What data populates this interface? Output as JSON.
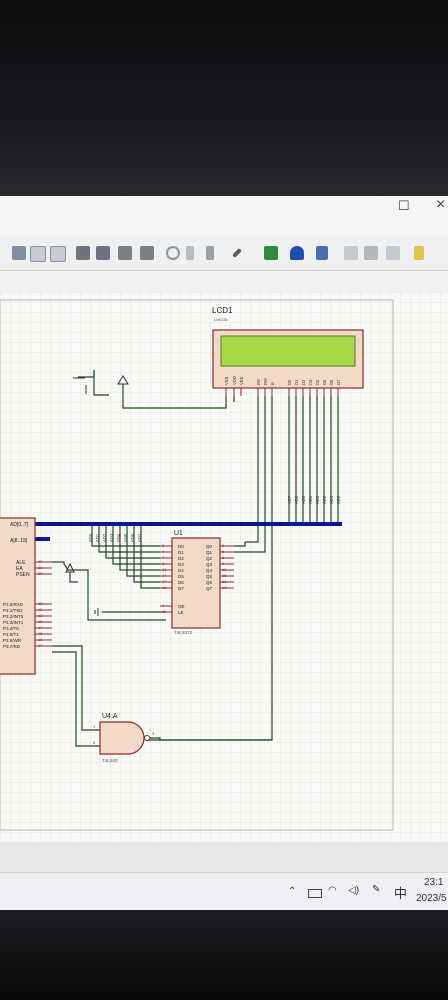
{
  "titlebar": {
    "maximize_glyph": "☐",
    "close_glyph": "×"
  },
  "toolbar": {
    "icons": [
      "cut-icon",
      "copy-icon",
      "paste-icon",
      "block-copy-icon",
      "block-move-icon",
      "block-rotate-icon",
      "block-delete-icon",
      "zoom-icon",
      "pick-device-icon",
      "make-device-icon",
      "decompose-icon",
      "wire-autorouter-icon",
      "search-icon",
      "property-tool-icon",
      "design-explorer-icon",
      "new-sheet-icon",
      "remove-sheet-icon",
      "export-icon"
    ]
  },
  "schematic": {
    "lcd": {
      "ref": "LCD1",
      "model": "LM016L",
      "pins": [
        "VSS",
        "VDD",
        "VEE",
        "RS",
        "RW",
        "E",
        "D0",
        "D1",
        "D2",
        "D3",
        "D4",
        "D5",
        "D6",
        "D7"
      ],
      "lcd_color": "#a8d84a"
    },
    "latch": {
      "ref": "U1",
      "model": "74LS373",
      "inputs": [
        "D0",
        "D1",
        "D2",
        "D3",
        "D4",
        "D5",
        "D6",
        "D7",
        "OE",
        "LE"
      ],
      "outputs": [
        "Q0",
        "Q1",
        "Q2",
        "Q3",
        "Q4",
        "Q5",
        "Q6",
        "Q7"
      ],
      "input_pin_nums": [
        "3",
        "4",
        "7",
        "8",
        "13",
        "14",
        "17",
        "18",
        "1",
        "11"
      ],
      "output_pin_nums": [
        "2",
        "5",
        "6",
        "9",
        "12",
        "15",
        "16",
        "19"
      ]
    },
    "gate": {
      "ref": "U4:A",
      "model": "74LS00",
      "pin_in1": "1",
      "pin_in2": "2",
      "pin_out": "3"
    },
    "mcu": {
      "left_labels": [
        "AD[0..7]",
        "A[8..15]"
      ],
      "control_labels": [
        "ALE",
        "EA",
        "PSEN"
      ],
      "control_pins": [
        "30",
        "31",
        "29"
      ],
      "port3_labels": [
        "P3.0/RXD",
        "P3.1/TXD",
        "P3.2/INT0",
        "P3.3/INT1",
        "P3.4/T0",
        "P3.5/T1",
        "P3.6/WR",
        "P3.7/RD"
      ],
      "port3_pins": [
        "10",
        "11",
        "12",
        "13",
        "14",
        "15",
        "16",
        "17"
      ]
    },
    "bus_labels_upper": [
      "AD0",
      "AD1",
      "AD2",
      "AD3",
      "AD4",
      "AD5",
      "AD6",
      "AD7"
    ],
    "bus_labels_lower": [
      "AD7",
      "AD6",
      "AD5",
      "AD4",
      "AD3",
      "AD2",
      "AD1",
      "AD0"
    ],
    "bus_color": "#0a1a8c",
    "wire_color": "#1f4a1f",
    "component_fill": "#f2d9c8",
    "component_stroke": "#8b2a2a"
  },
  "taskbar": {
    "ime": "中",
    "time": "23:1",
    "date": "2023/5"
  }
}
